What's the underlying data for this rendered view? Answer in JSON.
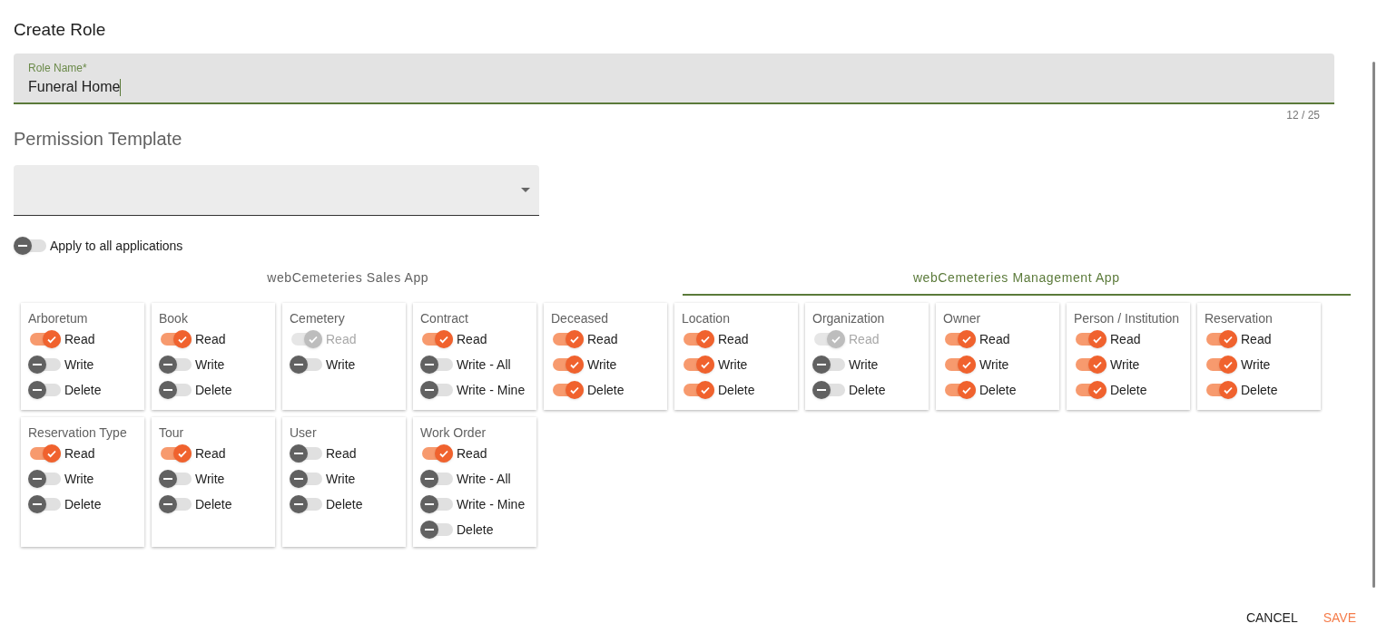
{
  "title": "Create Role",
  "role_name": {
    "label": "Role Name*",
    "value": "Funeral Home",
    "counter": "12 / 25"
  },
  "permission_template": {
    "heading": "Permission Template"
  },
  "apply_all": {
    "label": "Apply to all applications",
    "on": false
  },
  "tabs": [
    {
      "label": "webCemeteries Sales App",
      "selected": false
    },
    {
      "label": "webCemeteries Management App",
      "selected": true
    }
  ],
  "cards": [
    {
      "title": "Arboretum",
      "permissions": [
        {
          "label": "Read",
          "on": true,
          "disabled": false
        },
        {
          "label": "Write",
          "on": false,
          "disabled": false
        },
        {
          "label": "Delete",
          "on": false,
          "disabled": false
        }
      ]
    },
    {
      "title": "Book",
      "permissions": [
        {
          "label": "Read",
          "on": true,
          "disabled": false
        },
        {
          "label": "Write",
          "on": false,
          "disabled": false
        },
        {
          "label": "Delete",
          "on": false,
          "disabled": false
        }
      ]
    },
    {
      "title": "Cemetery",
      "permissions": [
        {
          "label": "Read",
          "on": true,
          "disabled": true
        },
        {
          "label": "Write",
          "on": false,
          "disabled": false
        }
      ]
    },
    {
      "title": "Contract",
      "permissions": [
        {
          "label": "Read",
          "on": true,
          "disabled": false
        },
        {
          "label": "Write - All",
          "on": false,
          "disabled": false
        },
        {
          "label": "Write - Mine",
          "on": false,
          "disabled": false
        }
      ]
    },
    {
      "title": "Deceased",
      "permissions": [
        {
          "label": "Read",
          "on": true,
          "disabled": false
        },
        {
          "label": "Write",
          "on": true,
          "disabled": false
        },
        {
          "label": "Delete",
          "on": true,
          "disabled": false
        }
      ]
    },
    {
      "title": "Location",
      "permissions": [
        {
          "label": "Read",
          "on": true,
          "disabled": false
        },
        {
          "label": "Write",
          "on": true,
          "disabled": false
        },
        {
          "label": "Delete",
          "on": true,
          "disabled": false
        }
      ]
    },
    {
      "title": "Organization",
      "permissions": [
        {
          "label": "Read",
          "on": true,
          "disabled": true
        },
        {
          "label": "Write",
          "on": false,
          "disabled": false
        },
        {
          "label": "Delete",
          "on": false,
          "disabled": false
        }
      ]
    },
    {
      "title": "Owner",
      "permissions": [
        {
          "label": "Read",
          "on": true,
          "disabled": false
        },
        {
          "label": "Write",
          "on": true,
          "disabled": false
        },
        {
          "label": "Delete",
          "on": true,
          "disabled": false
        }
      ]
    },
    {
      "title": "Person / Institution",
      "permissions": [
        {
          "label": "Read",
          "on": true,
          "disabled": false
        },
        {
          "label": "Write",
          "on": true,
          "disabled": false
        },
        {
          "label": "Delete",
          "on": true,
          "disabled": false
        }
      ]
    },
    {
      "title": "Reservation",
      "permissions": [
        {
          "label": "Read",
          "on": true,
          "disabled": false
        },
        {
          "label": "Write",
          "on": true,
          "disabled": false
        },
        {
          "label": "Delete",
          "on": true,
          "disabled": false
        }
      ]
    },
    {
      "title": "Reservation Type",
      "permissions": [
        {
          "label": "Read",
          "on": true,
          "disabled": false
        },
        {
          "label": "Write",
          "on": false,
          "disabled": false
        },
        {
          "label": "Delete",
          "on": false,
          "disabled": false
        }
      ]
    },
    {
      "title": "Tour",
      "permissions": [
        {
          "label": "Read",
          "on": true,
          "disabled": false
        },
        {
          "label": "Write",
          "on": false,
          "disabled": false
        },
        {
          "label": "Delete",
          "on": false,
          "disabled": false
        }
      ]
    },
    {
      "title": "User",
      "permissions": [
        {
          "label": "Read",
          "on": false,
          "disabled": false
        },
        {
          "label": "Write",
          "on": false,
          "disabled": false
        },
        {
          "label": "Delete",
          "on": false,
          "disabled": false
        }
      ]
    },
    {
      "title": "Work Order",
      "permissions": [
        {
          "label": "Read",
          "on": true,
          "disabled": false
        },
        {
          "label": "Write - All",
          "on": false,
          "disabled": false
        },
        {
          "label": "Write - Mine",
          "on": false,
          "disabled": false
        },
        {
          "label": "Delete",
          "on": false,
          "disabled": false
        }
      ]
    }
  ],
  "actions": [
    {
      "label": "CANCEL",
      "kind": "neutral"
    },
    {
      "label": "SAVE",
      "kind": "primary"
    }
  ]
}
